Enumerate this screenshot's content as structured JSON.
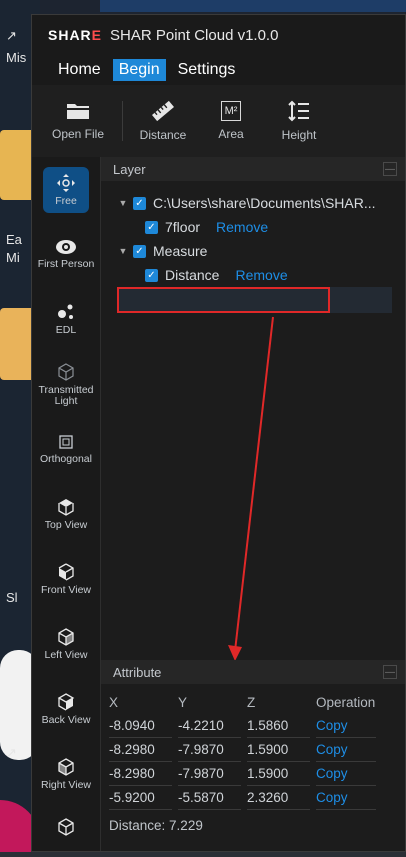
{
  "app": {
    "logo_left": "SHAR",
    "logo_accent": "E",
    "title": "SHAR Point Cloud v1.0.0"
  },
  "menu": [
    "Home",
    "Begin",
    "Settings"
  ],
  "menu_active": "Begin",
  "toolbar": [
    {
      "label": "Open File",
      "icon": "folder-icon"
    },
    {
      "label": "Distance",
      "icon": "ruler-icon"
    },
    {
      "label": "Area",
      "icon": "area-m2-icon",
      "glyph": "M²"
    },
    {
      "label": "Height",
      "icon": "height-icon"
    }
  ],
  "sidebar": [
    {
      "label": "Free",
      "icon": "move-icon",
      "active": true
    },
    {
      "label": "First Person",
      "icon": "eye-icon"
    },
    {
      "label": "EDL",
      "icon": "dots-icon"
    },
    {
      "label": "Transmitted Light",
      "icon": "cube-outline-icon"
    },
    {
      "label": "Orthogonal",
      "icon": "orthogonal-icon"
    },
    {
      "label": "Top View",
      "icon": "cube-top-icon"
    },
    {
      "label": "Front View",
      "icon": "cube-front-icon"
    },
    {
      "label": "Left View",
      "icon": "cube-left-icon"
    },
    {
      "label": "Back View",
      "icon": "cube-back-icon"
    },
    {
      "label": "Right View",
      "icon": "cube-right-icon"
    },
    {
      "label": "",
      "icon": "cube-bottom-icon"
    }
  ],
  "layer": {
    "title": "Layer",
    "path": "C:\\Users\\share\\Documents\\SHAR...",
    "floor_item": "7floor",
    "remove": "Remove",
    "measure": "Measure",
    "distance_item": "Distance"
  },
  "attribute": {
    "title": "Attribute",
    "columns": [
      "X",
      "Y",
      "Z",
      "Operation"
    ],
    "rows": [
      [
        "-8.0940",
        "-4.2210",
        "1.5860",
        "Copy"
      ],
      [
        "-8.2980",
        "-7.9870",
        "1.5900",
        "Copy"
      ],
      [
        "-8.2980",
        "-7.9870",
        "1.5900",
        "Copy"
      ],
      [
        "-5.9200",
        "-5.5870",
        "2.3260",
        "Copy"
      ]
    ],
    "distance_label": "Distance:",
    "distance_value": "7.229"
  },
  "desktop": {
    "fragments": [
      "Mis",
      "Ea",
      "Mi",
      "Sl"
    ]
  },
  "colors": {
    "accent": "#1e88d8",
    "link": "#1e8ee6",
    "annotation": "#e02828"
  }
}
